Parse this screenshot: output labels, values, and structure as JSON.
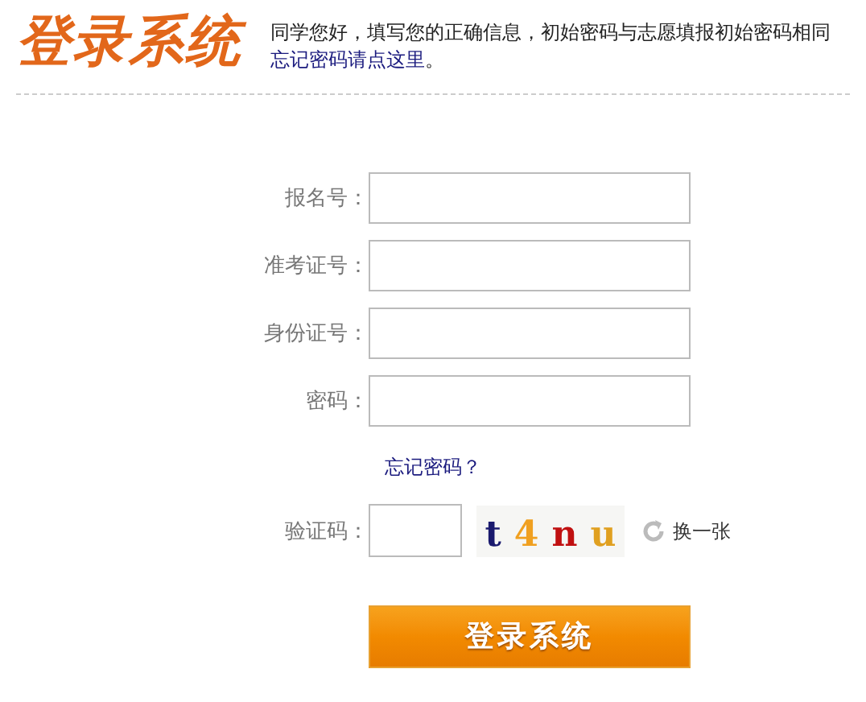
{
  "header": {
    "title": "登录系统",
    "notice": "同学您好，填写您的正确信息，初始密码与志愿填报初始密码相同",
    "reset_link": "忘记密码请点这里",
    "reset_suffix": "。"
  },
  "fields": [
    {
      "label": "报名号："
    },
    {
      "label": "准考证号："
    },
    {
      "label": "身份证号："
    },
    {
      "label": "密码："
    }
  ],
  "forgot_link": "忘记密码？",
  "captcha": {
    "label": "验证码：",
    "characters": [
      {
        "char": "t",
        "color": "#1a1a6e"
      },
      {
        "char": "4",
        "color": "#f0a020"
      },
      {
        "char": "n",
        "color": "#c01010"
      },
      {
        "char": "u",
        "color": "#e0a020"
      }
    ],
    "refresh": "换一张"
  },
  "submit": "登录系统"
}
